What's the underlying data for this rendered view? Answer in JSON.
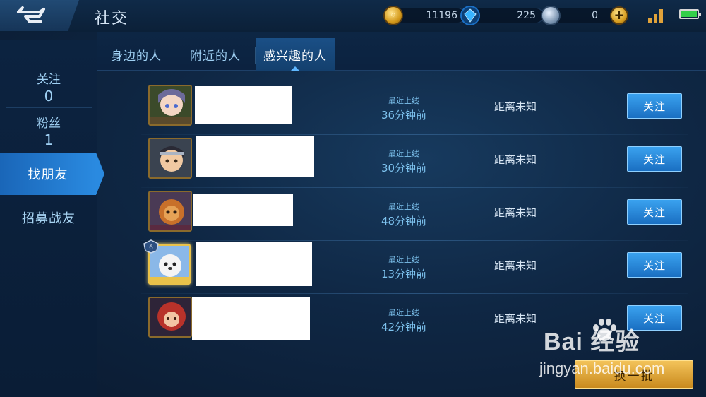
{
  "header": {
    "title": "社交",
    "gold": "11196",
    "diamonds": "225",
    "vouchers": "0",
    "coin_glyph": "",
    "plus_glyph": "+",
    "battery_level": 1.0,
    "signal_bars": 3
  },
  "sidebar": {
    "follow_label": "关注",
    "follow_count": "0",
    "fans_label": "粉丝",
    "fans_count": "1",
    "items": [
      {
        "label": "找朋友",
        "active": true
      },
      {
        "label": "招募战友",
        "active": false
      }
    ]
  },
  "tabs": [
    {
      "label": "身边的人",
      "active": false
    },
    {
      "label": "附近的人",
      "active": false
    },
    {
      "label": "感兴趣的人",
      "active": true
    }
  ],
  "players": [
    {
      "online_label": "最近上线",
      "online_time": "36分钟前",
      "distance": "距离未知",
      "follow_label": "关注"
    },
    {
      "online_label": "最近上线",
      "online_time": "30分钟前",
      "distance": "距离未知",
      "follow_label": "关注"
    },
    {
      "online_label": "最近上线",
      "online_time": "48分钟前",
      "distance": "距离未知",
      "follow_label": "关注"
    },
    {
      "online_label": "最近上线",
      "online_time": "13分钟前",
      "distance": "距离未知",
      "follow_label": "关注"
    },
    {
      "online_label": "最近上线",
      "online_time": "42分钟前",
      "distance": "距离未知",
      "follow_label": "关注"
    }
  ],
  "refresh_label": "换一批",
  "watermark": {
    "brand": "Bai 经验",
    "url": "jingyan.baidu.com"
  },
  "colors": {
    "accent_blue": "#2a8ae0",
    "gold": "#e0a23a",
    "battery": "#33d04a"
  }
}
